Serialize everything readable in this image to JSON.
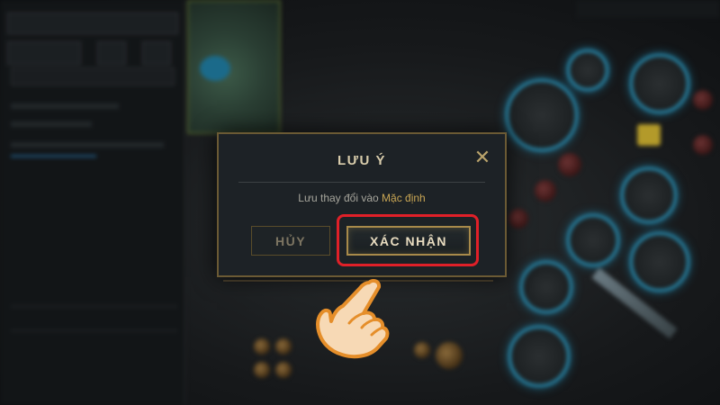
{
  "dialog": {
    "title": "LƯU Ý",
    "message_prefix": "Lưu thay đổi vào ",
    "message_highlight": "Mặc định",
    "close_icon": "close-icon",
    "cancel_label": "HỦY",
    "confirm_label": "XÁC NHẬN"
  },
  "colors": {
    "dialog_bg": "#1d2226",
    "gold_border": "#a88a4a",
    "highlight_text": "#c9a654",
    "tutorial_frame": "#e02028"
  },
  "overlay": {
    "pointer_icon": "hand-pointer-icon"
  }
}
